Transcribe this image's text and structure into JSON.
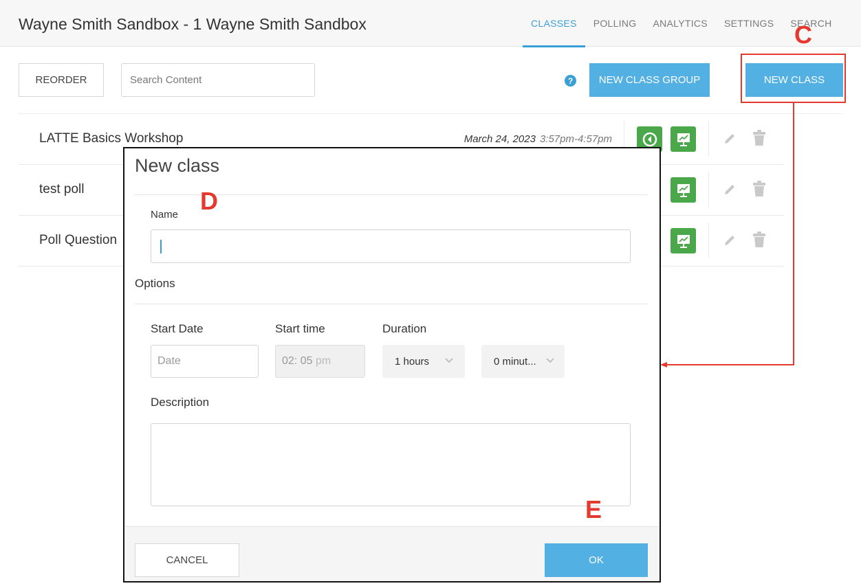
{
  "header": {
    "title": "Wayne Smith Sandbox - 1 Wayne Smith Sandbox",
    "tabs": [
      {
        "label": "CLASSES",
        "active": true
      },
      {
        "label": "POLLING",
        "active": false
      },
      {
        "label": "ANALYTICS",
        "active": false
      },
      {
        "label": "SETTINGS",
        "active": false
      },
      {
        "label": "SEARCH",
        "active": false
      }
    ]
  },
  "toolbar": {
    "reorder_label": "REORDER",
    "search_placeholder": "Search Content",
    "help_icon": "?",
    "new_group_label": "NEW CLASS GROUP",
    "new_class_label": "NEW CLASS"
  },
  "classes": [
    {
      "name": "LATTE Basics Workshop",
      "date": "March 24, 2023",
      "time": "3:57pm-4:57pm"
    },
    {
      "name": "test poll",
      "date": "",
      "time": ""
    },
    {
      "name": "Poll Question",
      "date": "",
      "time": ""
    }
  ],
  "annotations": {
    "c": "C",
    "d": "D",
    "e": "E"
  },
  "modal": {
    "title": "New class",
    "name_label": "Name",
    "name_value": "",
    "options_label": "Options",
    "start_date_label": "Start Date",
    "start_date_placeholder": "Date",
    "start_time_label": "Start time",
    "start_time_value": "02: 05",
    "start_time_ampm": "pm",
    "duration_label": "Duration",
    "duration_hours": "1 hours",
    "duration_minutes": "0 minut...",
    "description_label": "Description",
    "cancel_label": "CANCEL",
    "ok_label": "OK"
  },
  "colors": {
    "accent": "#52b0e3",
    "nav_active": "#3a9fd6",
    "action_green": "#4aa84a",
    "annotation_red": "#e3392f"
  }
}
